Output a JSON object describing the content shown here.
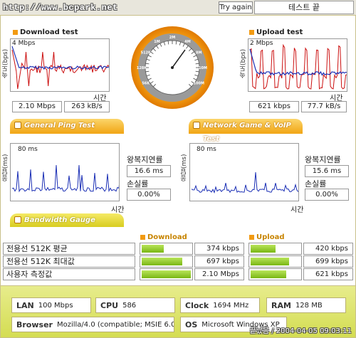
{
  "header": {
    "site_url": "http://www.bcpark.net",
    "try_again_label": "Try again",
    "test_status": "테스트 끝"
  },
  "download": {
    "title": "Download test",
    "ylabel": "속도(bps)",
    "ymax_label": "4 Mbps",
    "xlabel": "시간",
    "speed_bps": "2.10 Mbps",
    "speed_bytes": "263 kB/s"
  },
  "upload": {
    "title": "Upload test",
    "ylabel": "속도(bps)",
    "ymax_label": "2 Mbps",
    "xlabel": "시간",
    "speed_bps": "621 kbps",
    "speed_bytes": "77.7 kB/s"
  },
  "gauge": {
    "ticks": [
      "56K",
      "128K",
      "512K",
      "1M",
      "2M",
      "4M",
      "8M",
      "10M",
      "100M"
    ]
  },
  "tabs": {
    "ping": "General Ping Test",
    "game": "Network Game & VoIP Test",
    "bandwidth": "Bandwidth Gauge"
  },
  "ping_general": {
    "ylabel": "응답(ms)",
    "ymax_label": "80 ms",
    "xlabel": "시간",
    "rtt_label": "왕복지연률",
    "rtt_value": "16.6 ms",
    "loss_label": "손실률",
    "loss_value": "0.00%"
  },
  "ping_game": {
    "ylabel": "응답(ms)",
    "ymax_label": "80 ms",
    "xlabel": "시간",
    "rtt_label": "왕복지연률",
    "rtt_value": "15.6 ms",
    "loss_label": "손실률",
    "loss_value": "0.00%"
  },
  "bandwidth": {
    "download_header": "Download",
    "upload_header": "Upload",
    "rows": [
      {
        "label": "전용선 512K 평균",
        "download": "374 kbps",
        "download_fill": 0.45,
        "upload": "420 kbps",
        "upload_fill": 0.5
      },
      {
        "label": "전용선 512K 최대값",
        "download": "697 kbps",
        "download_fill": 0.82,
        "upload": "699 kbps",
        "upload_fill": 0.78
      },
      {
        "label": "사용자 측정값",
        "download": "2.10 Mbps",
        "download_fill": 1.0,
        "upload": "621 kbps",
        "upload_fill": 0.72
      }
    ]
  },
  "system": {
    "lan_key": "LAN",
    "lan_val": "100 Mbps",
    "cpu_key": "CPU",
    "cpu_val": "586",
    "clock_key": "Clock",
    "clock_val": "1694 MHz",
    "ram_key": "RAM",
    "ram_val": "128 MB",
    "browser_key": "Browser",
    "browser_val": "Mozilla/4.0 (compatible; MSIE 6.0",
    "os_key": "OS",
    "os_val": "Microsoft Windows XP"
  },
  "footer": "끝났음 / 2004-04-05 09:03:11",
  "colors": {
    "accent_orange": "#f2a91c",
    "bar_green": "#7ab714",
    "series_red": "#cc1111",
    "series_blue": "#1b2fb5"
  }
}
